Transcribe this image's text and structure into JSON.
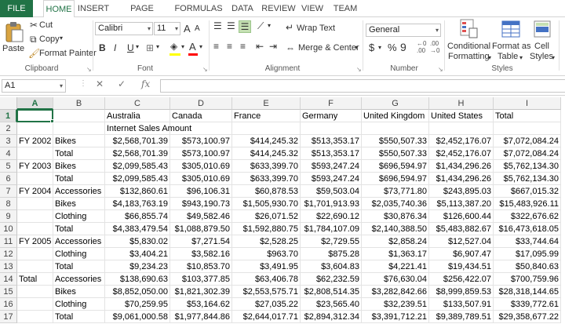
{
  "tabs": [
    "FILE",
    "HOME",
    "INSERT",
    "PAGE LAYOUT",
    "FORMULAS",
    "DATA",
    "REVIEW",
    "VIEW",
    "TEAM"
  ],
  "ribbon": {
    "clipboard": {
      "paste": "Paste",
      "cut": "Cut",
      "copy": "Copy",
      "format_painter": "Format Painter",
      "label": "Clipboard"
    },
    "font": {
      "name": "Calibri",
      "size": "11",
      "label": "Font",
      "bold": "B",
      "italic": "I",
      "underline": "U",
      "grow": "A",
      "shrink": "A"
    },
    "alignment": {
      "wrap_text": "Wrap Text",
      "merge_center": "Merge & Center",
      "label": "Alignment"
    },
    "number": {
      "format": "General",
      "currency": "$",
      "percent": "%",
      "comma": "9",
      "label": "Number"
    },
    "styles": {
      "conditional_formatting_1": "Conditional",
      "conditional_formatting_2": "Formatting",
      "format_as_table_1": "Format as",
      "format_as_table_2": "Table",
      "cell_styles_1": "Cell",
      "cell_styles_2": "Styles",
      "label": "Styles"
    }
  },
  "formula_bar": {
    "name_box": "A1",
    "fx": "fx",
    "formula": ""
  },
  "columns": [
    "A",
    "B",
    "C",
    "D",
    "E",
    "F",
    "G",
    "H",
    "I"
  ],
  "rows": [
    [
      "",
      "",
      "Australia",
      "Canada",
      "France",
      "Germany",
      "United Kingdom",
      "United States",
      "Total"
    ],
    [
      "",
      "",
      "Internet Sales Amount",
      "",
      "",
      "",
      "",
      "",
      ""
    ],
    [
      "FY 2002",
      "Bikes",
      "$2,568,701.39",
      "$573,100.97",
      "$414,245.32",
      "$513,353.17",
      "$550,507.33",
      "$2,452,176.07",
      "$7,072,084.24"
    ],
    [
      "",
      "Total",
      "$2,568,701.39",
      "$573,100.97",
      "$414,245.32",
      "$513,353.17",
      "$550,507.33",
      "$2,452,176.07",
      "$7,072,084.24"
    ],
    [
      "FY 2003",
      "Bikes",
      "$2,099,585.43",
      "$305,010.69",
      "$633,399.70",
      "$593,247.24",
      "$696,594.97",
      "$1,434,296.26",
      "$5,762,134.30"
    ],
    [
      "",
      "Total",
      "$2,099,585.43",
      "$305,010.69",
      "$633,399.70",
      "$593,247.24",
      "$696,594.97",
      "$1,434,296.26",
      "$5,762,134.30"
    ],
    [
      "FY 2004",
      "Accessories",
      "$132,860.61",
      "$96,106.31",
      "$60,878.53",
      "$59,503.04",
      "$73,771.80",
      "$243,895.03",
      "$667,015.32"
    ],
    [
      "",
      "Bikes",
      "$4,183,763.19",
      "$943,190.73",
      "$1,505,930.70",
      "$1,701,913.93",
      "$2,035,740.36",
      "$5,113,387.20",
      "$15,483,926.11"
    ],
    [
      "",
      "Clothing",
      "$66,855.74",
      "$49,582.46",
      "$26,071.52",
      "$22,690.12",
      "$30,876.34",
      "$126,600.44",
      "$322,676.62"
    ],
    [
      "",
      "Total",
      "$4,383,479.54",
      "$1,088,879.50",
      "$1,592,880.75",
      "$1,784,107.09",
      "$2,140,388.50",
      "$5,483,882.67",
      "$16,473,618.05"
    ],
    [
      "FY 2005",
      "Accessories",
      "$5,830.02",
      "$7,271.54",
      "$2,528.25",
      "$2,729.55",
      "$2,858.24",
      "$12,527.04",
      "$33,744.64"
    ],
    [
      "",
      "Clothing",
      "$3,404.21",
      "$3,582.16",
      "$963.70",
      "$875.28",
      "$1,363.17",
      "$6,907.47",
      "$17,095.99"
    ],
    [
      "",
      "Total",
      "$9,234.23",
      "$10,853.70",
      "$3,491.95",
      "$3,604.83",
      "$4,221.41",
      "$19,434.51",
      "$50,840.63"
    ],
    [
      "Total",
      "Accessories",
      "$138,690.63",
      "$103,377.85",
      "$63,406.78",
      "$62,232.59",
      "$76,630.04",
      "$256,422.07",
      "$700,759.96"
    ],
    [
      "",
      "Bikes",
      "$8,852,050.00",
      "$1,821,302.39",
      "$2,553,575.71",
      "$2,808,514.35",
      "$3,282,842.66",
      "$8,999,859.53",
      "$28,318,144.65"
    ],
    [
      "",
      "Clothing",
      "$70,259.95",
      "$53,164.62",
      "$27,035.22",
      "$23,565.40",
      "$32,239.51",
      "$133,507.91",
      "$339,772.61"
    ],
    [
      "",
      "Total",
      "$9,061,000.58",
      "$1,977,844.86",
      "$2,644,017.71",
      "$2,894,312.34",
      "$3,391,712.21",
      "$9,389,789.51",
      "$29,358,677.22"
    ]
  ],
  "colors": {
    "accent": "#217346",
    "selection_fill": "#c5e0b3"
  }
}
